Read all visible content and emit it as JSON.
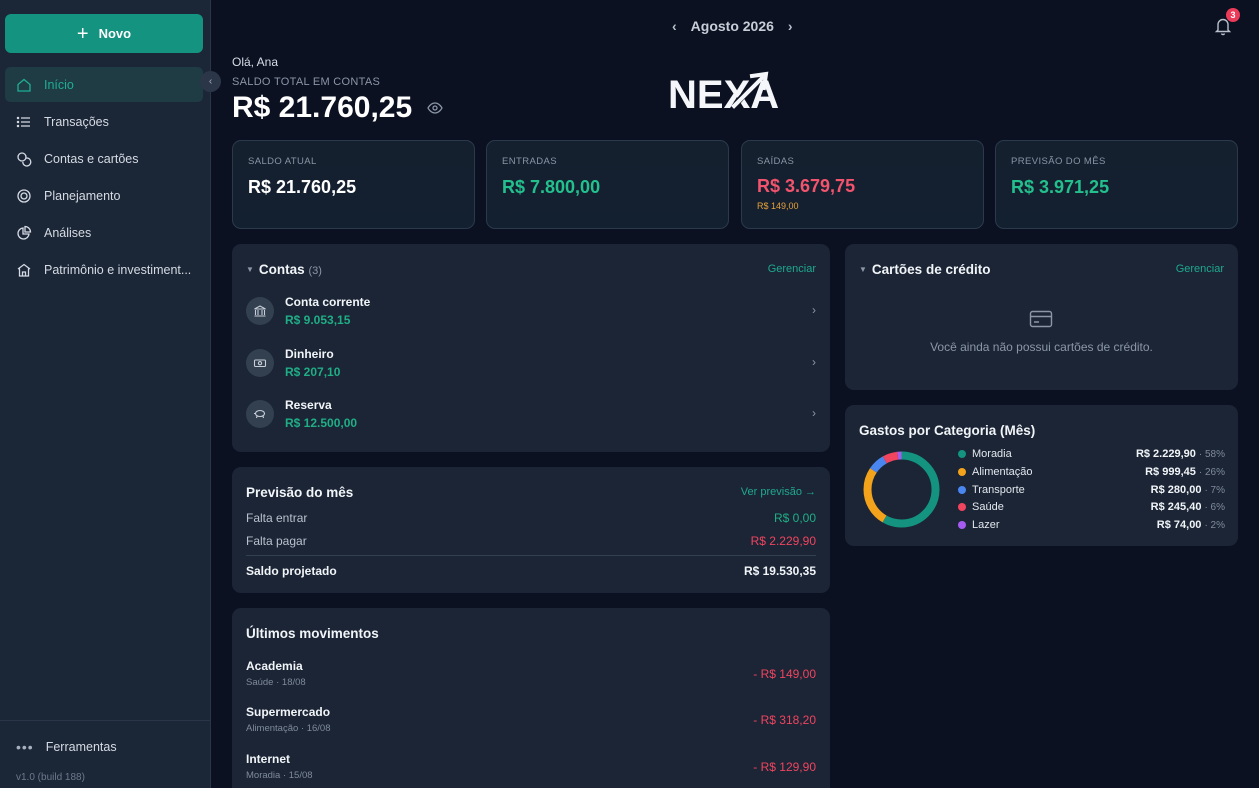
{
  "sidebar": {
    "new_label": "Novo",
    "collapse_icon": "‹",
    "items": [
      {
        "label": "Início",
        "icon": "home-icon",
        "active": true
      },
      {
        "label": "Transações",
        "icon": "list-icon"
      },
      {
        "label": "Contas e cartões",
        "icon": "coins-icon"
      },
      {
        "label": "Planejamento",
        "icon": "target-icon"
      },
      {
        "label": "Análises",
        "icon": "pie-icon"
      },
      {
        "label": "Patrimônio e investiment...",
        "icon": "building-icon"
      }
    ],
    "tools_label": "Ferramentas",
    "version": "v1.0 (build 188)"
  },
  "header": {
    "month": "Agosto 2026",
    "prev": "‹",
    "next": "›",
    "notifications": "3"
  },
  "hero": {
    "greeting": "Olá, Ana",
    "saldo_label": "SALDO TOTAL EM CONTAS",
    "saldo_value": "R$ 21.760,25",
    "logo_text": "NEXA"
  },
  "stats": [
    {
      "label": "SALDO ATUAL",
      "value": "R$ 21.760,25",
      "color": "#ffffff"
    },
    {
      "label": "ENTRADAS",
      "value": "R$ 7.800,00",
      "color": "#23c08e"
    },
    {
      "label": "SAÍDAS",
      "value": "R$ 3.679,75",
      "color": "#f2536d",
      "sub": "R$ 149,00"
    },
    {
      "label": "PREVISÃO DO MÊS",
      "value": "R$ 3.971,25",
      "color": "#23c08e"
    }
  ],
  "contas": {
    "title": "Contas",
    "count": "(3)",
    "manage": "Gerenciar",
    "items": [
      {
        "name": "Conta corrente",
        "amount": "R$ 9.053,15",
        "icon": "bank-icon"
      },
      {
        "name": "Dinheiro",
        "amount": "R$ 207,10",
        "icon": "cash-icon"
      },
      {
        "name": "Reserva",
        "amount": "R$ 12.500,00",
        "icon": "piggy-icon"
      }
    ]
  },
  "cartoes": {
    "title": "Cartões de crédito",
    "manage": "Gerenciar",
    "empty": "Você ainda não possui cartões de crédito."
  },
  "previsao": {
    "title": "Previsão do mês",
    "link": "Ver previsão →",
    "rows": [
      {
        "label": "Falta entrar",
        "value": "R$ 0,00",
        "color": "#1fae86"
      },
      {
        "label": "Falta pagar",
        "value": "R$ 2.229,90",
        "color": "#f0445f"
      }
    ],
    "total_label": "Saldo projetado",
    "total_value": "R$ 19.530,35"
  },
  "movimentos": {
    "title": "Últimos movimentos",
    "items": [
      {
        "name": "Academia",
        "meta": "Saúde · 18/08",
        "amount": "- R$ 149,00"
      },
      {
        "name": "Supermercado",
        "meta": "Alimentação · 16/08",
        "amount": "- R$ 318,20"
      },
      {
        "name": "Internet",
        "meta": "Moradia · 15/08",
        "amount": "- R$ 129,90"
      }
    ]
  },
  "gastos": {
    "title": "Gastos por Categoria (Mês)",
    "legend": [
      {
        "name": "Moradia",
        "value": "R$ 2.229,90",
        "pct": "· 58%"
      },
      {
        "name": "Alimentação",
        "value": "R$ 999,45",
        "pct": "· 26%"
      },
      {
        "name": "Transporte",
        "value": "R$ 280,00",
        "pct": "· 7%"
      },
      {
        "name": "Saúde",
        "value": "R$ 245,40",
        "pct": "· 6%"
      },
      {
        "name": "Lazer",
        "value": "R$ 74,00",
        "pct": "· 2%"
      }
    ]
  },
  "chart_data": {
    "type": "pie",
    "title": "Gastos por Categoria (Mês)",
    "categories": [
      "Moradia",
      "Alimentação",
      "Transporte",
      "Saúde",
      "Lazer"
    ],
    "values": [
      2229.9,
      999.45,
      280.0,
      245.4,
      74.0
    ],
    "colors": [
      "#149380",
      "#f2a21b",
      "#4a86f0",
      "#f0445f",
      "#a45cf0"
    ],
    "legend": "right"
  }
}
